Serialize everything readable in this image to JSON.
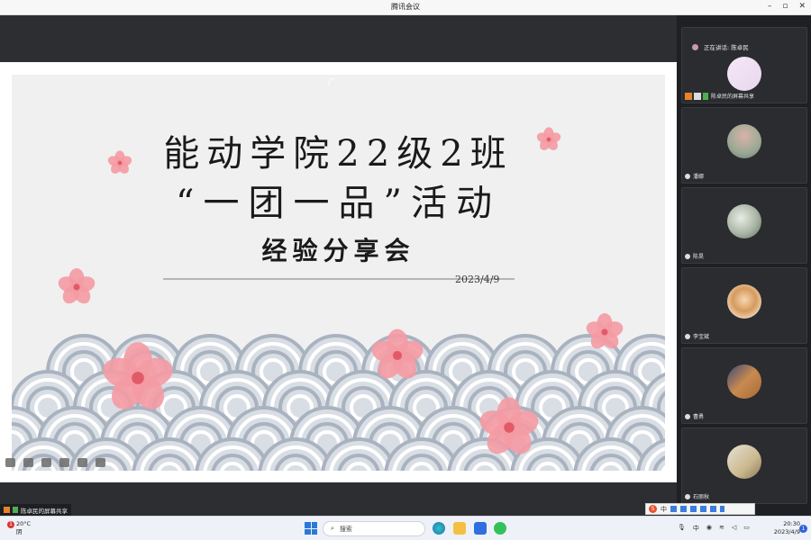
{
  "window": {
    "title": "腾讯会议",
    "controls": [
      "–",
      "▫",
      "✕"
    ]
  },
  "slide": {
    "line1": "能动学院22级2班",
    "line2": "“一团一品”活动",
    "line3": "经验分享会",
    "date": "2023/4/9"
  },
  "sidebar": {
    "speaking_label": "正在讲话: 陈卓民",
    "participants": [
      {
        "name": "陈卓民的屏幕共享"
      },
      {
        "name": "潘娜"
      },
      {
        "name": "陈昊"
      },
      {
        "name": "李宝斌"
      },
      {
        "name": "曹勇"
      },
      {
        "name": "石丽秋"
      }
    ]
  },
  "share_label": "陈卓民的屏幕共享",
  "ime": {
    "logo": "S",
    "text": "中"
  },
  "taskbar": {
    "weather_temp": "20°C",
    "weather_desc": "阴",
    "weather_badge": "1",
    "search_placeholder": "搜索",
    "time": "20:30",
    "date": "2023/4/9",
    "notif_count": "1"
  },
  "colors": {
    "accent": "#2b78d8",
    "blossom": "#f28c96",
    "wave": "#a9b2bf"
  }
}
